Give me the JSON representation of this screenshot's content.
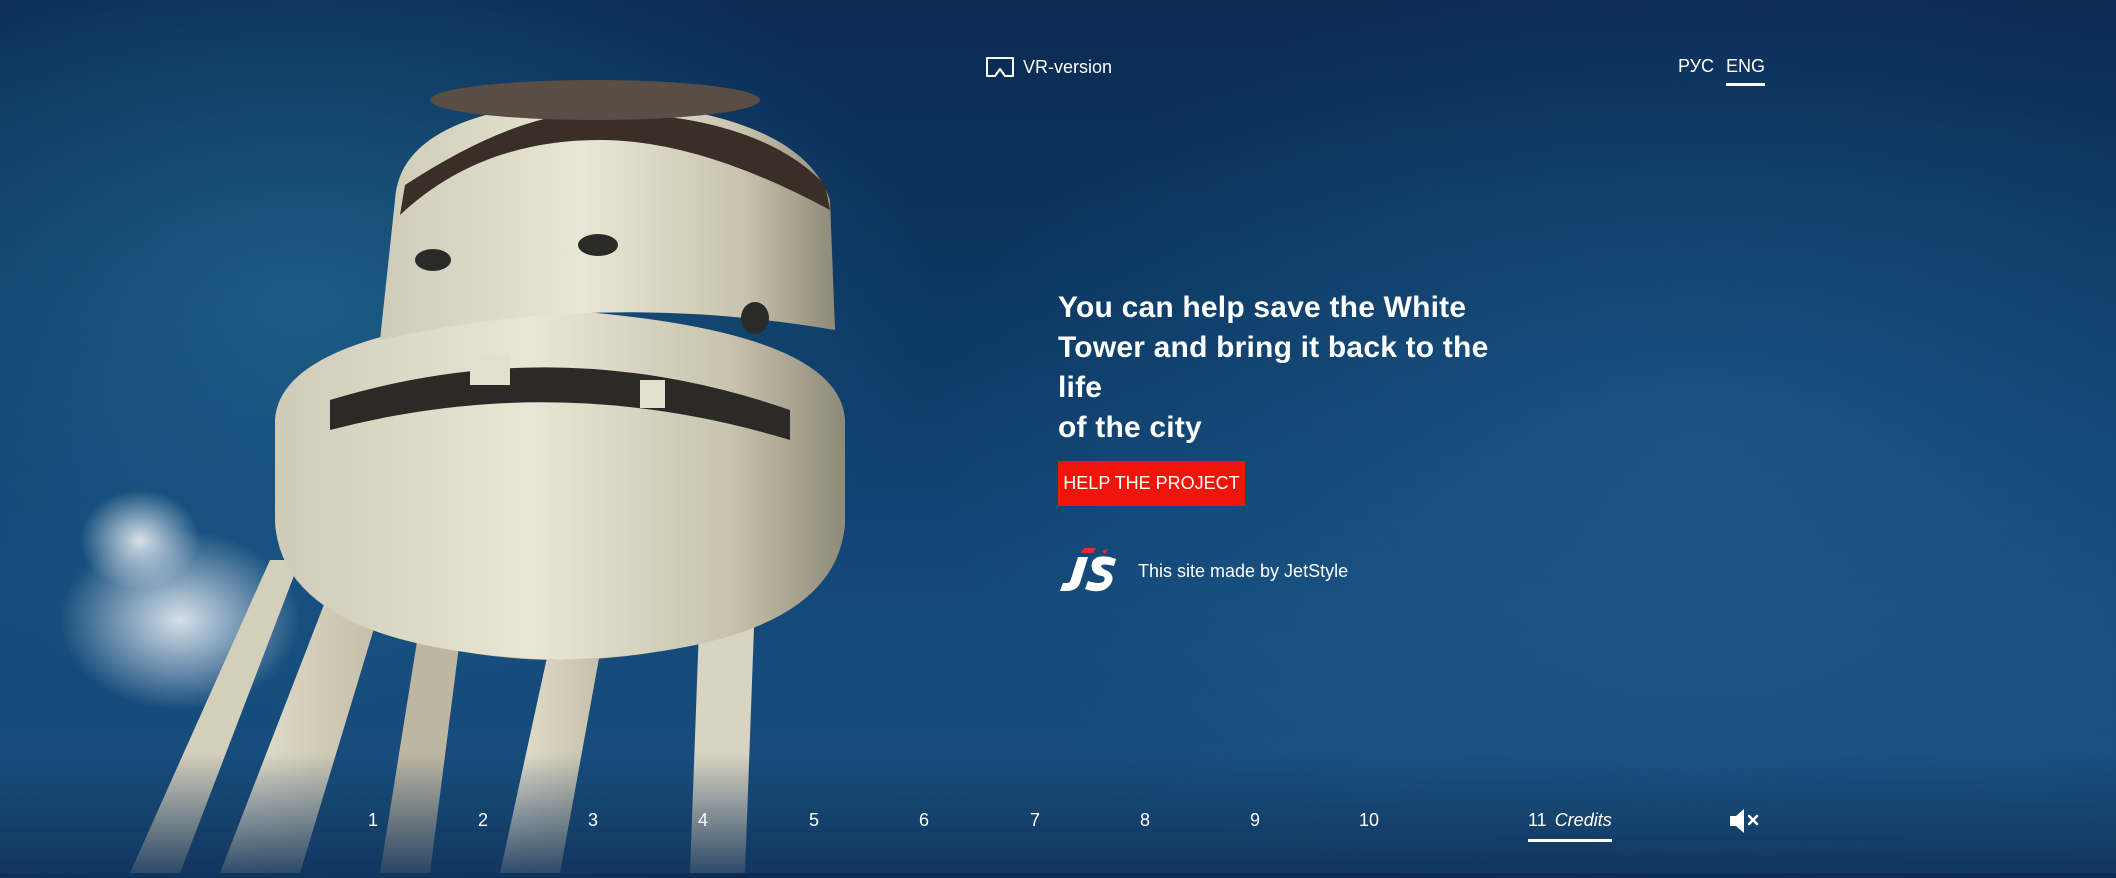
{
  "header": {
    "vr_label": "VR-version",
    "languages": [
      {
        "label": "РУС",
        "active": false
      },
      {
        "label": "ENG",
        "active": true
      }
    ]
  },
  "main": {
    "headline": "You can help save the White\nTower and bring it back to the life\nof the city",
    "cta_label": "HELP THE PROJECT",
    "logo_text": "JS",
    "maker_text": "This site made by JetStyle"
  },
  "nav": {
    "pages": [
      "1",
      "2",
      "3",
      "4",
      "5",
      "6",
      "7",
      "8",
      "9",
      "10"
    ],
    "credits_number": "11",
    "credits_label": "Credits"
  },
  "colors": {
    "cta": "#f0150a",
    "logo_accent": "#e8283c"
  },
  "icons": {
    "vr": "vr-headset-icon",
    "mute": "speaker-muted-icon"
  }
}
